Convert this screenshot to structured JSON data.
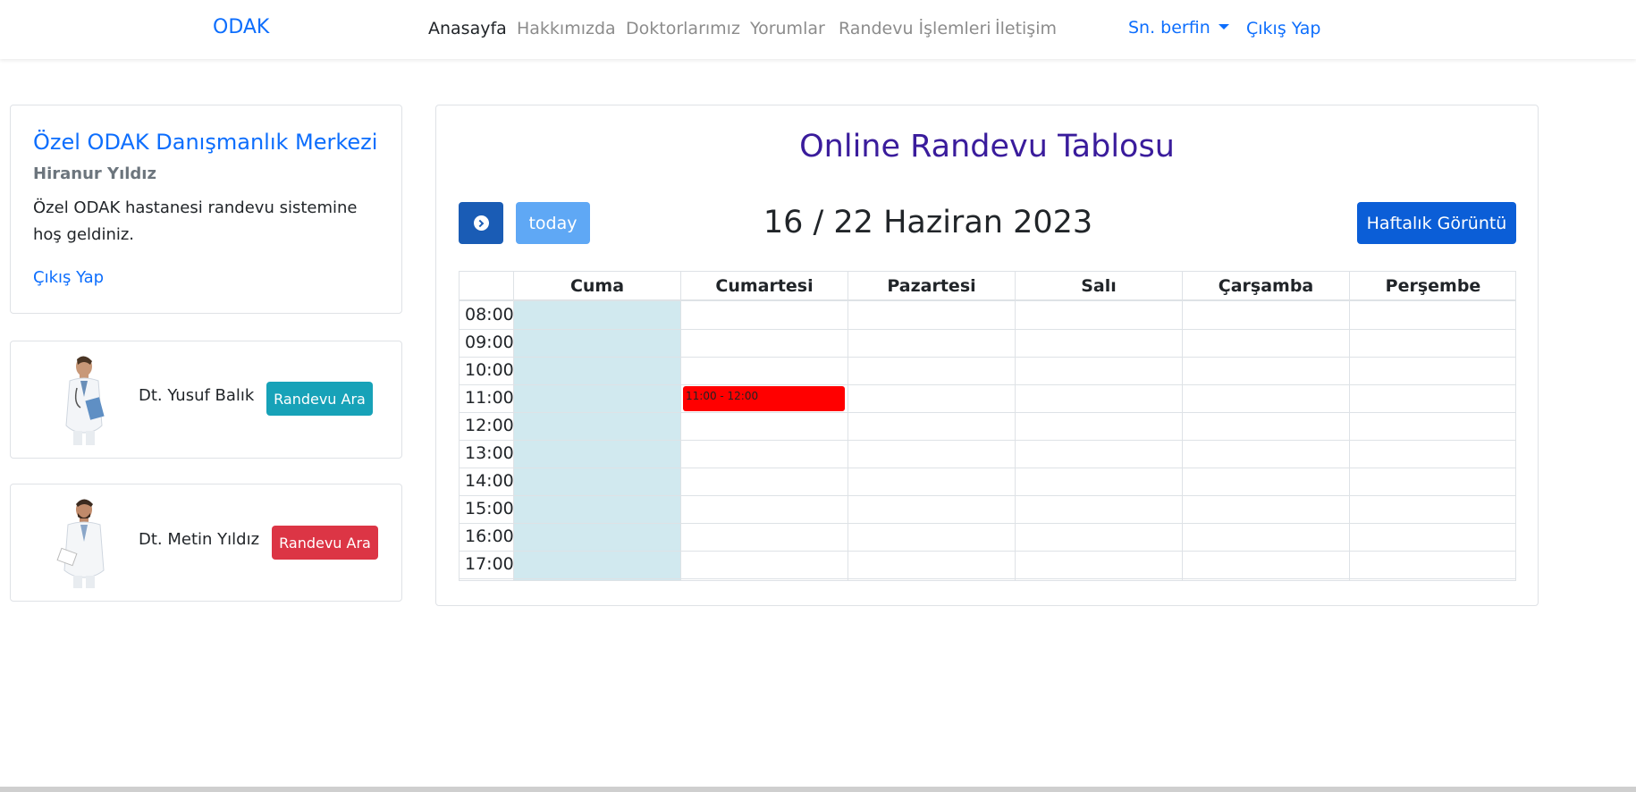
{
  "navbar": {
    "brand": "ODAK",
    "links": [
      "Anasayfa",
      "Hakkımızda",
      "Doktorlarımız",
      "Yorumlar",
      "Randevu İşlemleri",
      "İletişim"
    ],
    "user": "Sn. berfin",
    "logout": "Çıkış Yap"
  },
  "info": {
    "title": "Özel ODAK Danışmanlık Merkezi",
    "subtitle": "Hiranur Yıldız",
    "text": "Özel ODAK hastanesi randevu sistemine hoş geldiniz.",
    "logout": "Çıkış Yap"
  },
  "doctors": [
    {
      "name": "Dt. Yusuf Balık",
      "button": "Randevu Ara",
      "button_color": "#17a2b8"
    },
    {
      "name": "Dt. Metin Yıldız",
      "button": "Randevu Ara",
      "button_color": "#dc3545"
    }
  ],
  "calendar": {
    "title": "Online Randevu Tablosu",
    "today_label": "today",
    "date_range": "16 / 22 Haziran 2023",
    "view_button": "Haftalık Görüntü",
    "days": [
      "Cuma",
      "Cumartesi",
      "Pazartesi",
      "Salı",
      "Çarşamba",
      "Perşembe"
    ],
    "times": [
      "08:00",
      "09:00",
      "10:00",
      "11:00",
      "12:00",
      "13:00",
      "14:00",
      "15:00",
      "16:00",
      "17:00"
    ],
    "today_day": "Cuma",
    "events": [
      {
        "day": "Cumartesi",
        "label": "11:00 - 12:00",
        "start": "11:00",
        "color": "#ff0000"
      }
    ]
  },
  "colors": {
    "primary": "#0d6efd",
    "title": "#3a1c9c",
    "today_highlight": "#d1e9ef"
  }
}
